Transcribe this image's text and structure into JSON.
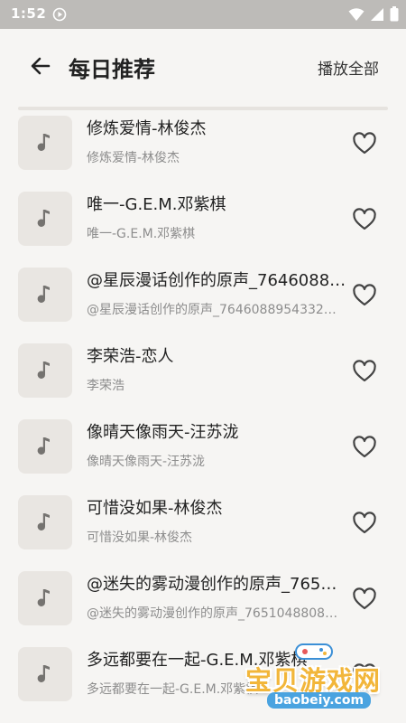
{
  "status_bar": {
    "time": "1:52"
  },
  "header": {
    "title": "每日推荐",
    "play_all": "播放全部"
  },
  "songs": [
    {
      "title": "修炼爱情-林俊杰",
      "subtitle": "修炼爱情-林俊杰"
    },
    {
      "title": "唯一-G.E.M.邓紫棋",
      "subtitle": "唯一-G.E.M.邓紫棋"
    },
    {
      "title": "@星辰漫话创作的原声_7646088…",
      "subtitle": "@星辰漫话创作的原声_76460889543322…"
    },
    {
      "title": "李荣浩-恋人",
      "subtitle": "李荣浩"
    },
    {
      "title": "像晴天像雨天-汪苏泷",
      "subtitle": "像晴天像雨天-汪苏泷"
    },
    {
      "title": "可惜没如果-林俊杰",
      "subtitle": "可惜没如果-林俊杰"
    },
    {
      "title": "@迷失的雾动漫创作的原声_765…",
      "subtitle": "@迷失的雾动漫创作的原声_7651048808…"
    },
    {
      "title": "多远都要在一起-G.E.M.邓紫棋",
      "subtitle": "多远都要在一起-G.E.M.邓紫棋"
    }
  ],
  "watermark": {
    "text": "宝贝游戏网",
    "url": "baobeiy.com"
  },
  "icons": {
    "back": "arrow-left-icon",
    "cover": "music-note-icon",
    "favorite": "heart-outline-icon"
  },
  "colors": {
    "status_bar": "#bdbbb8",
    "background": "#f6f5f3",
    "cover": "#e9e6e2",
    "subtitle": "#8d8d8d"
  }
}
